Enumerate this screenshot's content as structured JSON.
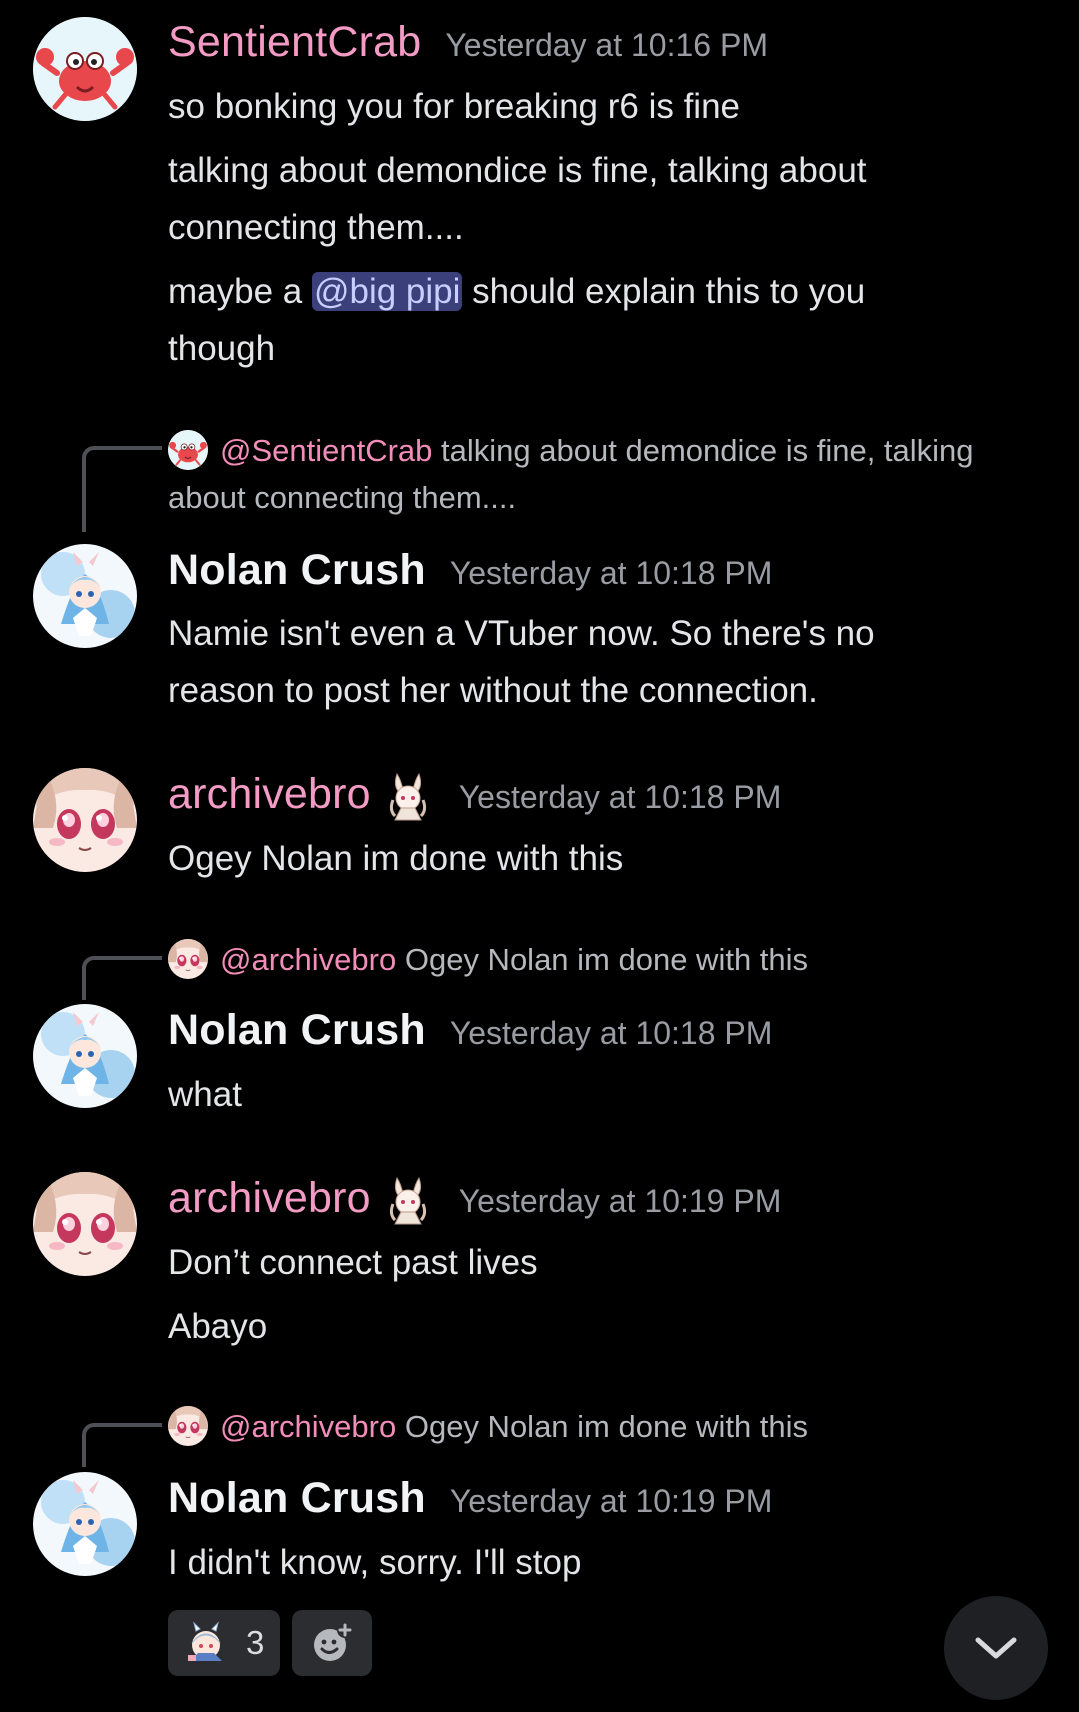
{
  "colors": {
    "background": "#000000",
    "username_pink": "#f39bc4",
    "username_white": "#f2f3f5",
    "timestamp": "#9a9ca3",
    "mention_bg": "#3b3f7a",
    "reaction_bg": "#2b2d31"
  },
  "messages": [
    {
      "author": "SentientCrab",
      "timestamp": "Yesterday at 10:16 PM",
      "avatar_icon": "crab-avatar",
      "lines": [
        {
          "text": "so bonking you for breaking r6 is fine"
        },
        {
          "text": "talking about demondice is fine, talking about"
        },
        {
          "text": "connecting them...."
        },
        {
          "before": "maybe a ",
          "mention": "@big pipi",
          "after": " should explain this to you"
        },
        {
          "text": "though"
        }
      ]
    },
    {
      "reply_to": {
        "name": "@SentientCrab",
        "text_line1": "talking about demondice is fine, talking",
        "text_line2": "about connecting them...."
      },
      "author": "Nolan Crush",
      "timestamp": "Yesterday at 10:18 PM",
      "avatar_icon": "anime-girl-blue-avatar",
      "lines": [
        {
          "text": "Namie isn't even a VTuber now. So there's no"
        },
        {
          "text": "reason to post her without the connection."
        }
      ]
    },
    {
      "author": "archivebro",
      "timestamp": "Yesterday at 10:18 PM",
      "avatar_icon": "anime-face-avatar",
      "badge_icon": "bunny-girl-badge-icon",
      "lines": [
        {
          "text": "Ogey Nolan im done with this"
        }
      ]
    },
    {
      "reply_to": {
        "name": "@archivebro",
        "text_line1": "Ogey Nolan im done with this"
      },
      "author": "Nolan Crush",
      "timestamp": "Yesterday at 10:18 PM",
      "avatar_icon": "anime-girl-blue-avatar",
      "lines": [
        {
          "text": "what"
        }
      ]
    },
    {
      "author": "archivebro",
      "timestamp": "Yesterday at 10:19 PM",
      "avatar_icon": "anime-face-avatar",
      "badge_icon": "bunny-girl-badge-icon",
      "lines": [
        {
          "text": "Don’t connect past lives"
        },
        {
          "text": "Abayo"
        }
      ]
    },
    {
      "reply_to": {
        "name": "@archivebro",
        "text_line1": "Ogey Nolan im done with this"
      },
      "author": "Nolan Crush",
      "timestamp": "Yesterday at 10:19 PM",
      "avatar_icon": "anime-girl-blue-avatar",
      "lines": [
        {
          "text": "I didn't know, sorry. I'll stop"
        }
      ],
      "reactions": [
        {
          "emoji_icon": "pekora-emoji-icon",
          "count": "3"
        }
      ]
    }
  ],
  "add_reaction_icon": "add-reaction-icon",
  "scroll_down_icon": "chevron-down-icon"
}
